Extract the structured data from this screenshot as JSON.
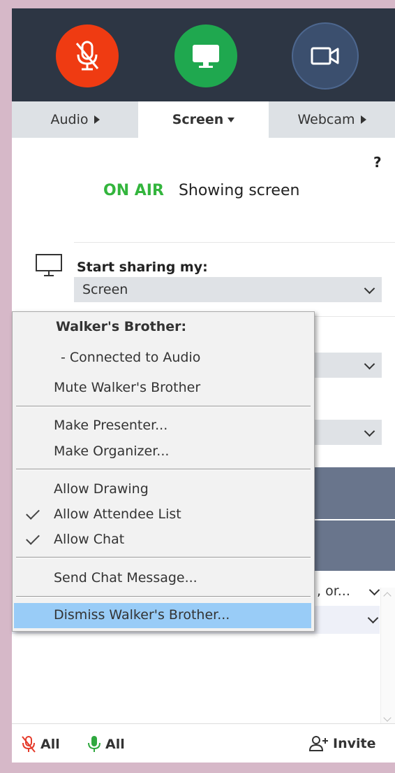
{
  "toolbar": {
    "mic_icon": "mic-muted-icon",
    "screen_icon": "monitor-icon",
    "webcam_icon": "video-camera-icon",
    "colors": {
      "mic": "#ef3b12",
      "screen": "#1fa84f",
      "webcam": "#3b4f6e"
    }
  },
  "tabs": {
    "audio": "Audio",
    "screen": "Screen",
    "webcam": "Webcam"
  },
  "help_label": "?",
  "status": {
    "on_air": "ON AIR",
    "message": "Showing screen"
  },
  "share": {
    "title": "Start sharing my:",
    "selected": "Screen"
  },
  "partial_select": ", or...",
  "context_menu": {
    "title": "Walker's Brother:",
    "status": "- Connected to Audio",
    "mute": "Mute Walker's Brother",
    "make_presenter": "Make Presenter...",
    "make_organizer": "Make Organizer...",
    "allow_drawing": "Allow Drawing",
    "allow_attendee_list": "Allow Attendee List",
    "allow_chat": "Allow Chat",
    "send_chat": "Send Chat Message...",
    "dismiss": "Dismiss Walker's Brother..."
  },
  "footer": {
    "mute_all": "All",
    "unmute_all": "All",
    "invite": "Invite"
  }
}
